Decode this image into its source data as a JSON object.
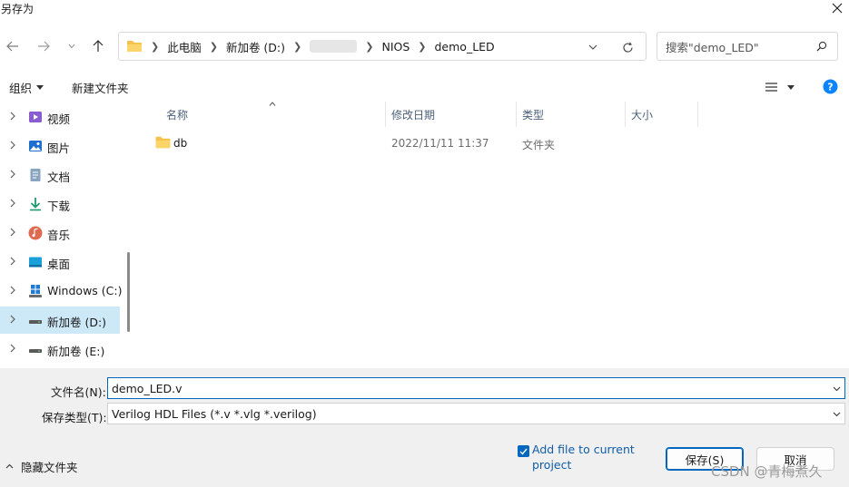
{
  "window": {
    "title": "另存为"
  },
  "nav": {
    "breadcrumbs": [
      "此电脑",
      "新加卷 (D:)",
      "NIOS",
      "demo_LED"
    ],
    "search_placeholder": "搜索\"demo_LED\""
  },
  "commands": {
    "organize": "组织",
    "new_folder": "新建文件夹"
  },
  "sidebar": {
    "items": [
      {
        "label": "视频",
        "icon": "video-icon"
      },
      {
        "label": "图片",
        "icon": "pictures-icon"
      },
      {
        "label": "文档",
        "icon": "documents-icon"
      },
      {
        "label": "下载",
        "icon": "download-icon"
      },
      {
        "label": "音乐",
        "icon": "music-icon"
      },
      {
        "label": "桌面",
        "icon": "desktop-icon"
      },
      {
        "label": "Windows (C:)",
        "icon": "windows-drive-icon"
      },
      {
        "label": "新加卷 (D:)",
        "icon": "drive-icon",
        "selected": true
      },
      {
        "label": "新加卷 (E:)",
        "icon": "drive-icon"
      }
    ]
  },
  "file_list": {
    "columns": [
      "名称",
      "修改日期",
      "类型",
      "大小"
    ],
    "rows": [
      {
        "name": "db",
        "modified": "2022/11/11 11:37",
        "type": "文件夹",
        "size": ""
      }
    ]
  },
  "form": {
    "filename_label": "文件名(N):",
    "filename_value": "demo_LED.v",
    "filetype_label": "保存类型(T):",
    "filetype_value": "Verilog HDL Files (*.v *.vlg *.verilog)",
    "add_to_project_label": "Add file to current project",
    "add_to_project_checked": true
  },
  "footer": {
    "hide_folders": "隐藏文件夹",
    "save_button": "保存(S)",
    "cancel_button": "取消",
    "watermark": "CSDN @青梅煮久"
  },
  "colors": {
    "accent": "#0067c0",
    "selection": "#cde8f7",
    "folder": "#f4c24d",
    "help": "#0a84ff"
  }
}
